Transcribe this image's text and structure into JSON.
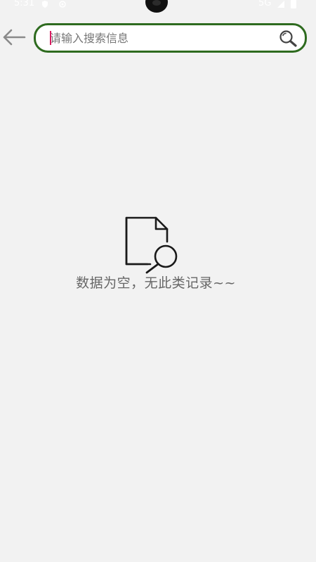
{
  "status_bar": {
    "time": "5:31",
    "network": "5G"
  },
  "toolbar": {
    "back_icon": "arrow-left-icon",
    "search": {
      "placeholder": "请输入搜索信息",
      "value": "",
      "icon": "search-icon"
    }
  },
  "empty_state": {
    "icon": "document-search-icon",
    "message": "数据为空，无此类记录~~"
  },
  "colors": {
    "background": "#f2f2f2",
    "search_border": "#2e6b1f",
    "caret": "#d81b60",
    "text_muted": "#666666"
  }
}
